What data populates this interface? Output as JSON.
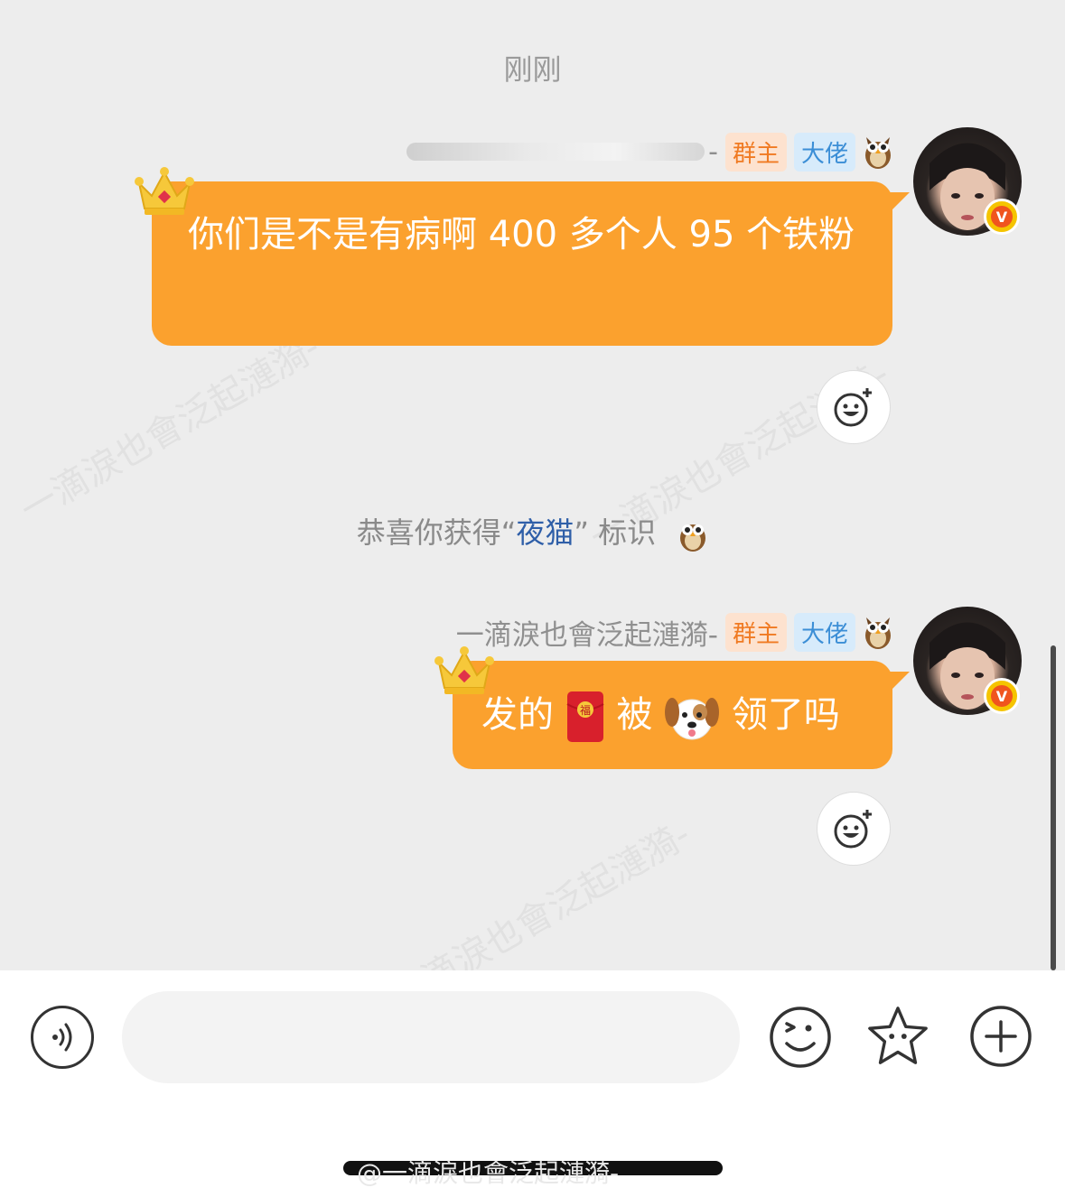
{
  "timestamp": "刚刚",
  "messages": [
    {
      "sender_name": "",
      "sender_suffix": "-",
      "badges": [
        "群主",
        "大佬"
      ],
      "text": "你们是不是有病啊 400 多个人 95 个铁粉"
    },
    {
      "sender_name": "一滴淚也會泛起漣漪-",
      "badges": [
        "群主",
        "大佬"
      ],
      "text_parts": [
        "发的",
        "被",
        "领了吗"
      ]
    }
  ],
  "system_notice": {
    "prefix": "恭喜你获得",
    "open_quote": "“",
    "highlight": "夜猫",
    "close_quote": "”",
    "suffix": " 标识"
  },
  "icons": {
    "owl": "owl-icon",
    "crown": "crown-icon",
    "red_envelope": "red-envelope-icon",
    "dog": "dog-face-icon",
    "react": "add-reaction-icon",
    "voice": "voice-icon",
    "emoji": "emoji-icon",
    "sticker": "star-sticker-icon",
    "plus": "plus-icon"
  },
  "input": {
    "placeholder": ""
  },
  "watermark": "一滴淚也會泛起漣漪-",
  "credit": "@一滴淚也會泛起漣漪-",
  "colors": {
    "bubble": "#fba12e",
    "badge_owner": "#f07a22",
    "badge_boss": "#3b8ed6",
    "highlight": "#2f5fa8"
  }
}
